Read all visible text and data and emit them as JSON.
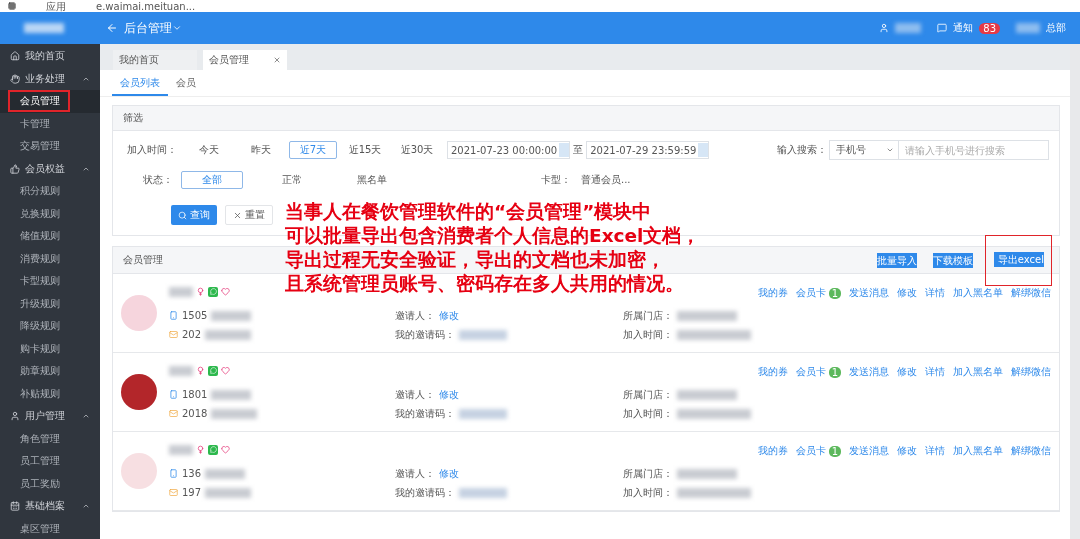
{
  "bookmarks": [
    "应用",
    "e.waimai.meituan..."
  ],
  "header": {
    "title": "后台管理",
    "notice_label": "通知",
    "notice_count": "83",
    "org_suffix": "总部"
  },
  "sidebar": [
    {
      "kind": "home",
      "label": "我的首页"
    },
    {
      "kind": "hand",
      "label": "业务处理",
      "expanded": true,
      "children": [
        {
          "label": "会员管理",
          "selected": true,
          "highlighted": true
        },
        {
          "label": "卡管理",
          "selected": false,
          "highlighted": false
        },
        {
          "label": "交易管理",
          "selected": false,
          "highlighted": false
        }
      ]
    },
    {
      "kind": "thumb",
      "label": "会员权益",
      "expanded": true,
      "children": [
        {
          "label": "积分规则",
          "selected": false,
          "highlighted": false
        },
        {
          "label": "兑换规则",
          "selected": false,
          "highlighted": false
        },
        {
          "label": "储值规则",
          "selected": false,
          "highlighted": false
        },
        {
          "label": "消费规则",
          "selected": false,
          "highlighted": false
        },
        {
          "label": "卡型规则",
          "selected": false,
          "highlighted": false
        },
        {
          "label": "升级规则",
          "selected": false,
          "highlighted": false
        },
        {
          "label": "降级规则",
          "selected": false,
          "highlighted": false
        },
        {
          "label": "购卡规则",
          "selected": false,
          "highlighted": false
        },
        {
          "label": "勋章规则",
          "selected": false,
          "highlighted": false
        },
        {
          "label": "补贴规则",
          "selected": false,
          "highlighted": false
        }
      ]
    },
    {
      "kind": "user",
      "label": "用户管理",
      "expanded": true,
      "children": [
        {
          "label": "角色管理",
          "selected": false,
          "highlighted": false
        },
        {
          "label": "员工管理",
          "selected": false,
          "highlighted": false
        },
        {
          "label": "员工奖励",
          "selected": false,
          "highlighted": false
        }
      ]
    },
    {
      "kind": "archive",
      "label": "基础档案",
      "expanded": true,
      "children": [
        {
          "label": "桌区管理",
          "selected": false,
          "highlighted": false
        }
      ]
    }
  ],
  "page_tabs": [
    {
      "label": "我的首页",
      "selected": false,
      "closable": false
    },
    {
      "label": "会员管理",
      "selected": true,
      "closable": true
    }
  ],
  "sub_tabs": [
    {
      "label": "会员列表",
      "selected": true
    },
    {
      "label": "会员",
      "selected": false
    }
  ],
  "filter": {
    "title": "筛选",
    "join_time_label": "加入时间：",
    "time_options": [
      {
        "label": "今天",
        "selected": false
      },
      {
        "label": "昨天",
        "selected": false
      },
      {
        "label": "近7天",
        "selected": true
      },
      {
        "label": "近15天",
        "selected": false
      },
      {
        "label": "近30天",
        "selected": false
      }
    ],
    "date_from": "2021-07-23 00:00:00",
    "date_sep": "至",
    "date_to": "2021-07-29 23:59:59",
    "search_label": "输入搜索：",
    "search_type": "手机号",
    "search_placeholder": "请输入手机号进行搜索",
    "status_label": "状态：",
    "status_options": [
      {
        "label": "全部",
        "selected": true
      },
      {
        "label": "正常",
        "selected": false
      },
      {
        "label": "黑名单",
        "selected": false
      }
    ],
    "card_type_label": "卡型：",
    "card_type_value": "普通会员...",
    "query_button": "查询",
    "reset_button": "重置"
  },
  "members_panel": {
    "title": "会员管理",
    "buttons": [
      {
        "label": "批量导入",
        "highlighted": false
      },
      {
        "label": "下载模板",
        "highlighted": false
      },
      {
        "label": "导出excel",
        "highlighted": true
      }
    ],
    "members": [
      {
        "color": "#f6d5dd",
        "phone": "1505",
        "date": "202",
        "inviter_label": "邀请人：",
        "inviter_link": "修改",
        "code_label": "我的邀请码：",
        "store_label": "所属门店：",
        "join_label": "加入时间：",
        "actions": [
          {
            "label": "我的券"
          },
          {
            "label": "会员卡",
            "badge": "1"
          },
          {
            "label": "发送消息"
          },
          {
            "label": "修改"
          },
          {
            "label": "详情"
          },
          {
            "label": "加入黑名单"
          },
          {
            "label": "解绑微信"
          }
        ]
      },
      {
        "color": "#b3262a",
        "phone": "1801",
        "date": "2018",
        "inviter_label": "邀请人：",
        "inviter_link": "修改",
        "code_label": "我的邀请码：",
        "store_label": "所属门店：",
        "join_label": "加入时间：",
        "actions": [
          {
            "label": "我的券"
          },
          {
            "label": "会员卡",
            "badge": "1"
          },
          {
            "label": "发送消息"
          },
          {
            "label": "修改"
          },
          {
            "label": "详情"
          },
          {
            "label": "加入黑名单"
          },
          {
            "label": "解绑微信"
          }
        ]
      },
      {
        "color": "#f7dfe2",
        "phone": "136",
        "date": "197",
        "inviter_label": "邀请人：",
        "inviter_link": "修改",
        "code_label": "我的邀请码：",
        "store_label": "所属门店：",
        "join_label": "加入时间：",
        "actions": [
          {
            "label": "我的券"
          },
          {
            "label": "会员卡",
            "badge": "1"
          },
          {
            "label": "发送消息"
          },
          {
            "label": "修改"
          },
          {
            "label": "详情"
          },
          {
            "label": "加入黑名单"
          },
          {
            "label": "解绑微信"
          }
        ]
      }
    ]
  },
  "annotation": [
    "当事人在餐饮管理软件的“会员管理”模块中",
    "可以批量导出包含消费者个人信息的Excel文档，",
    "导出过程无安全验证，导出的文档也未加密，",
    "且系统管理员账号、密码存在多人共用的情况。"
  ]
}
